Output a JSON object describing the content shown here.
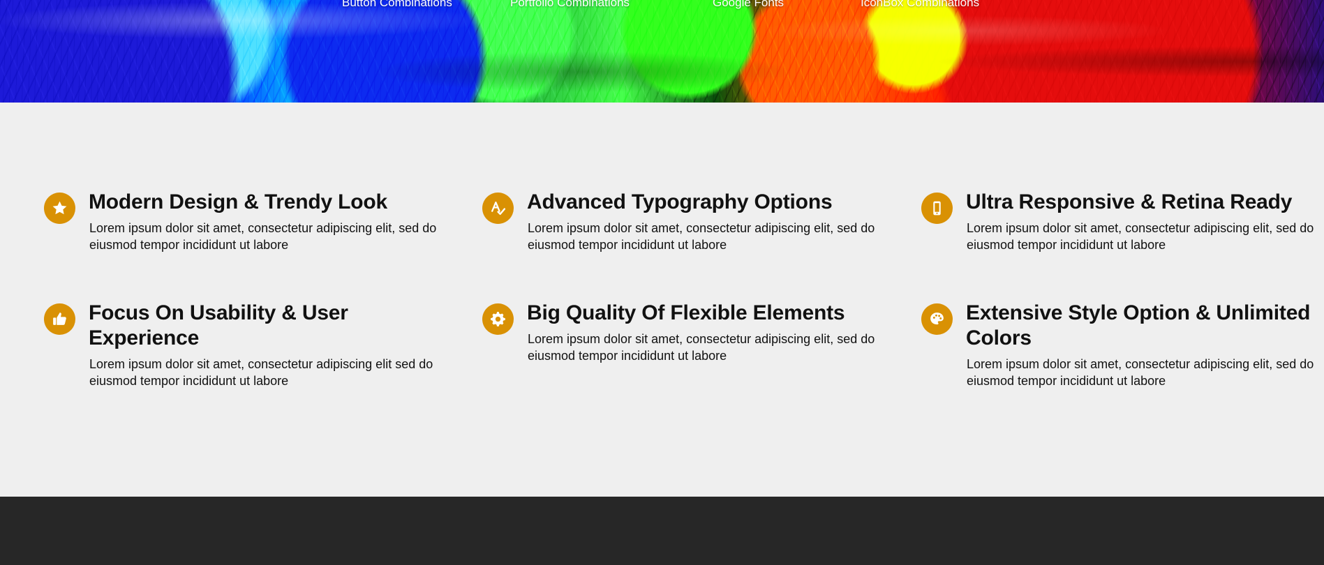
{
  "hero": {
    "nav": [
      {
        "label": "Button Combinations"
      },
      {
        "label": "Portfolio Combinations"
      },
      {
        "label": "Google Fonts"
      },
      {
        "label": "IconBox Combinations"
      }
    ]
  },
  "features": [
    {
      "icon": "star-icon",
      "title": "Modern Design & Trendy Look",
      "text": "Lorem ipsum dolor sit amet, consectetur adipiscing elit, sed do eiusmod tempor incididunt ut labore"
    },
    {
      "icon": "spellcheck-icon",
      "title": "Advanced Typography Options",
      "text": "Lorem ipsum dolor sit amet, consectetur adipiscing elit, sed do eiusmod tempor incididunt ut labore"
    },
    {
      "icon": "mobile-phone-icon",
      "title": "Ultra Responsive & Retina Ready",
      "text": "Lorem ipsum dolor sit amet, consectetur adipiscing elit, sed do eiusmod tempor incididunt ut labore"
    },
    {
      "icon": "thumbs-up-icon",
      "title": "Focus On Usability & User Experience",
      "text": "Lorem ipsum dolor sit amet, consectetur adipiscing elit sed do eiusmod tempor incididunt ut labore"
    },
    {
      "icon": "gear-icon",
      "title": "Big Quality Of Flexible Elements",
      "text": "Lorem ipsum dolor sit amet, consectetur adipiscing elit, sed do eiusmod tempor incididunt ut labore"
    },
    {
      "icon": "palette-icon",
      "title": "Extensive Style Option & Unlimited Colors",
      "text": "Lorem ipsum dolor sit amet, consectetur adipiscing elit, sed do eiusmod tempor incididunt ut labore"
    }
  ],
  "colors": {
    "accent": "#d99104",
    "background": "#efefef",
    "footer": "#272727",
    "text": "#111111",
    "nav_text": "#ffffff"
  }
}
